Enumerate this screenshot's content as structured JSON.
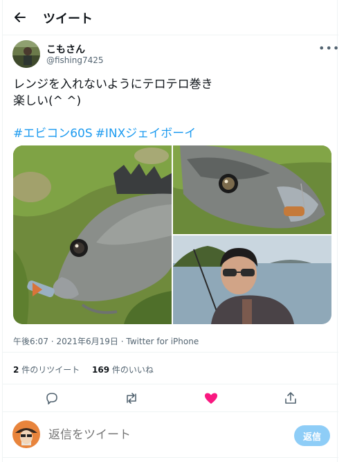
{
  "header": {
    "title": "ツイート",
    "back_icon": "arrow-left-icon"
  },
  "author": {
    "display_name": "こもさん",
    "handle": "@fishing7425"
  },
  "tweet": {
    "lines": [
      "レンジを入れないようにテロテロ巻き",
      "楽しい(^ ^)"
    ],
    "hashtags": [
      "#エビコン60S",
      "#INXジェイボーイ"
    ]
  },
  "media": {
    "count": 3,
    "photos": [
      "fish-photo-left",
      "fish-photo-top-right",
      "angler-photo-bottom-right"
    ]
  },
  "meta": {
    "time": "午後6:07",
    "date": "2021年6月19日",
    "source": "Twitter for iPhone",
    "dot": "·"
  },
  "stats": {
    "retweets": {
      "count": "2",
      "label": "件のリツイート"
    },
    "likes": {
      "count": "169",
      "label": "件のいいね"
    }
  },
  "actions": {
    "reply_icon": "reply-icon",
    "retweet_icon": "retweet-icon",
    "like_icon": "heart-icon",
    "share_icon": "share-icon",
    "like_color": "#f91880",
    "icon_color": "#536471"
  },
  "reply": {
    "placeholder": "返信をツイート",
    "button_label": "返信"
  },
  "colors": {
    "accent": "#1d9bf0",
    "reply_button": "#8ecdf7",
    "border": "#eff3f4"
  }
}
